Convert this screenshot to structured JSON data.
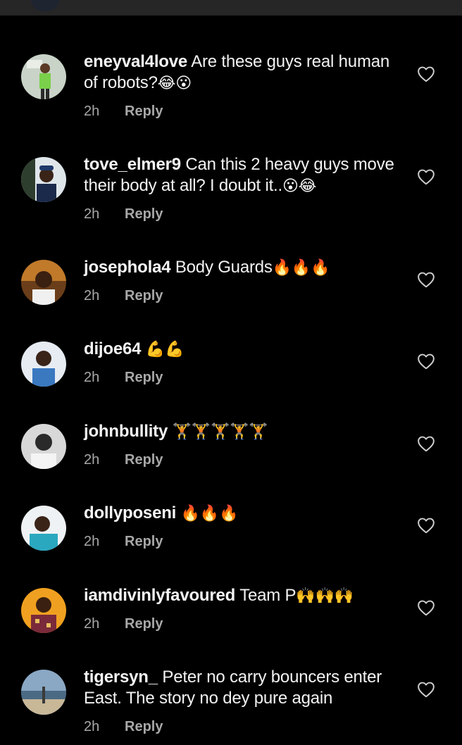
{
  "comments": [
    {
      "username": "eneyval4love",
      "text": "Are these guys real human of robots?",
      "emoji": "😂😮",
      "time": "2h",
      "reply": "Reply",
      "avatar_color": "#b8c8b8"
    },
    {
      "username": "tove_elmer9",
      "text": "Can this 2 heavy guys move their body at all? I doubt it..",
      "emoji": "😮😂",
      "time": "2h",
      "reply": "Reply",
      "avatar_color": "#3a4a5a"
    },
    {
      "username": "josephola4",
      "text": "Body Guards",
      "emoji": "🔥🔥🔥",
      "time": "2h",
      "reply": "Reply",
      "avatar_color": "#8a5a2a"
    },
    {
      "username": "dijoe64",
      "text": "",
      "emoji": "💪💪",
      "time": "2h",
      "reply": "Reply",
      "avatar_color": "#9ab8d8"
    },
    {
      "username": "johnbullity",
      "text": "",
      "emoji": "🏋🏋🏋🏋🏋",
      "time": "2h",
      "reply": "Reply",
      "avatar_color": "#c8c8c8"
    },
    {
      "username": "dollyposeni",
      "text": "",
      "emoji": "🔥🔥🔥",
      "time": "2h",
      "reply": "Reply",
      "avatar_color": "#3ab0c8"
    },
    {
      "username": "iamdivinlyfavoured",
      "text": "Team P",
      "emoji": "🙌🙌🙌",
      "time": "2h",
      "reply": "Reply",
      "avatar_color": "#e8a030"
    },
    {
      "username": "tigersyn_",
      "text": "Peter no carry bouncers enter East. The story no dey pure again",
      "emoji": "",
      "time": "2h",
      "reply": "Reply",
      "avatar_color": "#7a98b0"
    }
  ]
}
